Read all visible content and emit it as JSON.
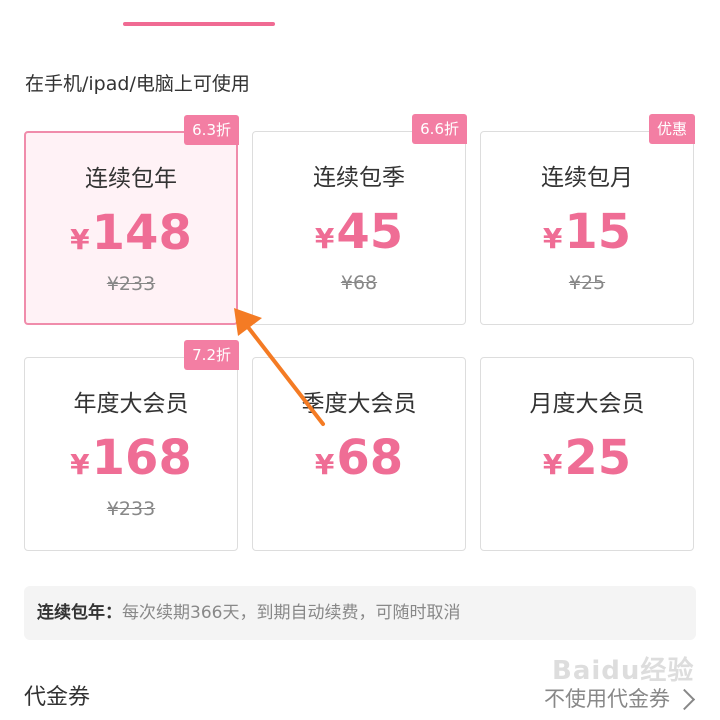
{
  "subtitle": "在手机/ipad/电脑上可使用",
  "currency_symbol": "¥",
  "accent_color": "#ef6d95",
  "plans": [
    {
      "title": "连续包年",
      "price": "148",
      "original": "¥233",
      "badge": "6.3折",
      "selected": true
    },
    {
      "title": "连续包季",
      "price": "45",
      "original": "¥68",
      "badge": "6.6折",
      "selected": false
    },
    {
      "title": "连续包月",
      "price": "15",
      "original": "¥25",
      "badge": "优惠",
      "selected": false
    },
    {
      "title": "年度大会员",
      "price": "168",
      "original": "¥233",
      "badge": "7.2折",
      "selected": false
    },
    {
      "title": "季度大会员",
      "price": "68",
      "selected": false
    },
    {
      "title": "月度大会员",
      "price": "25",
      "selected": false
    }
  ],
  "info": {
    "label": "连续包年：",
    "text": "每次续期366天，到期自动续费，可随时取消"
  },
  "voucher": {
    "label": "代金券",
    "value": "不使用代金券"
  },
  "watermark": "Baidu经验",
  "icons": {
    "chevron": "chevron-right-icon",
    "arrow": "annotation-arrow"
  }
}
